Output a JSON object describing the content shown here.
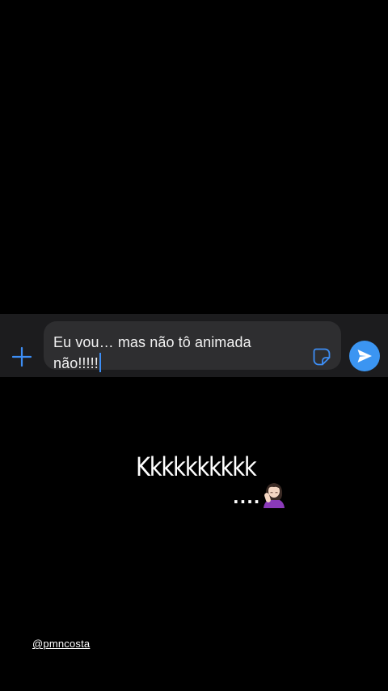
{
  "composer": {
    "message_text": "Eu vou… mas não tô animada\nnão!!!!!",
    "plus_icon": "plus-icon",
    "sticker_icon": "sticker-icon",
    "send_icon": "send-icon",
    "accent_color": "#3b95f2"
  },
  "story": {
    "caption": "Kkkkkkkkkk",
    "dots": "....",
    "emoji": "woman-facepalming-emoji",
    "mention": "@pmncosta"
  }
}
